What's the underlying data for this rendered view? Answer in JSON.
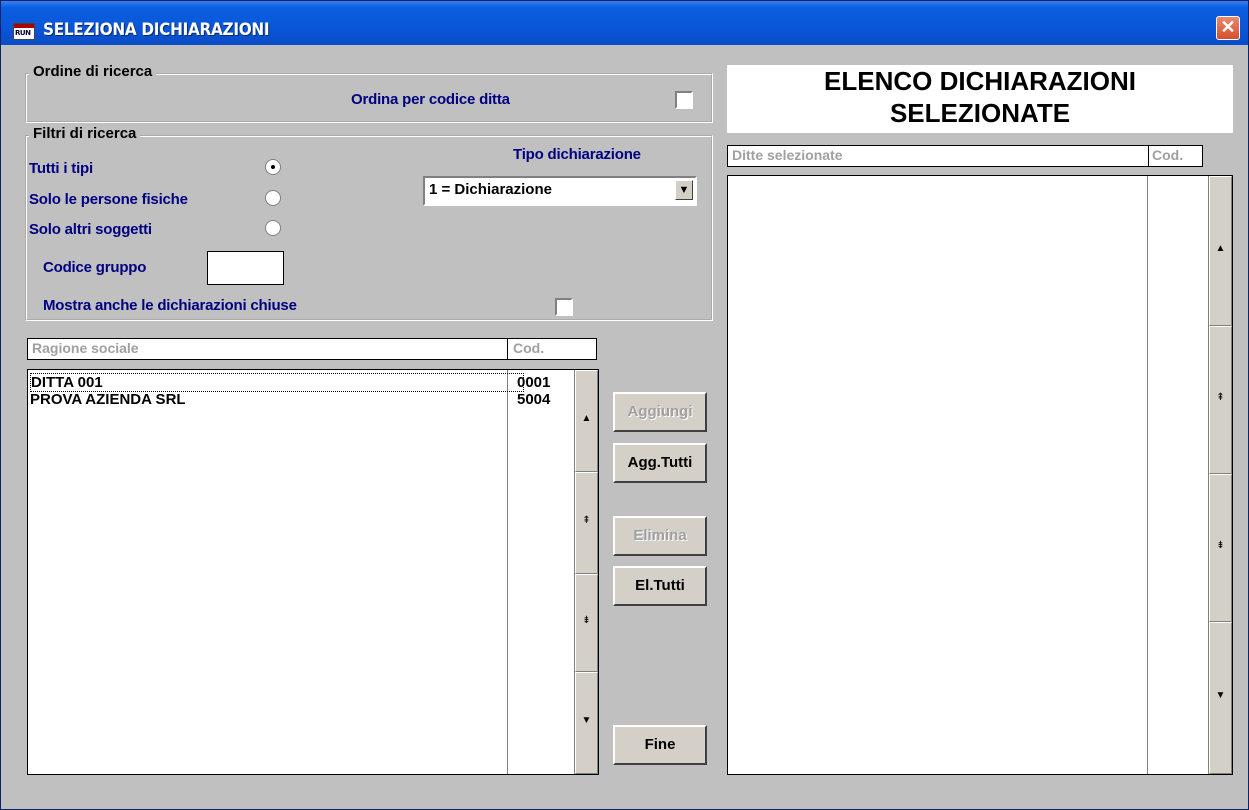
{
  "window": {
    "title": "SELEZIONA DICHIARAZIONI",
    "icon": "RUN"
  },
  "ordine": {
    "group_label": "Ordine di ricerca",
    "ordina_label": "Ordina per codice ditta"
  },
  "filtri": {
    "group_label": "Filtri di ricerca",
    "tipo_label": "Tipo dichiarazione",
    "tipo_value": "1 = Dichiarazione",
    "radio_tutti": "Tutti i tipi",
    "radio_fisiche": "Solo le persone fisiche",
    "radio_altri": "Solo altri soggetti",
    "codice_gruppo_label": "Codice gruppo",
    "codice_gruppo_value": "",
    "mostra_chiuse_label": "Mostra anche le dichiarazioni chiuse"
  },
  "left_list": {
    "col_ragione": "Ragione sociale",
    "col_cod": "Cod.",
    "rows": [
      {
        "name": "DITTA 001",
        "cod": "0001"
      },
      {
        "name": "PROVA AZIENDA SRL",
        "cod": "5004"
      }
    ]
  },
  "buttons": {
    "aggiungi": "Aggiungi",
    "agg_tutti": "Agg.Tutti",
    "elimina": "Elimina",
    "el_tutti": "El.Tutti",
    "fine": "Fine"
  },
  "right_panel": {
    "title_line1": "ELENCO DICHIARAZIONI",
    "title_line2": "SELEZIONATE",
    "col_ditte": "Ditte selezionate",
    "col_cod": "Cod."
  },
  "scroll_glyphs": {
    "up": "▲",
    "page_up": "⇞",
    "page_down": "⇟",
    "down": "▼"
  }
}
